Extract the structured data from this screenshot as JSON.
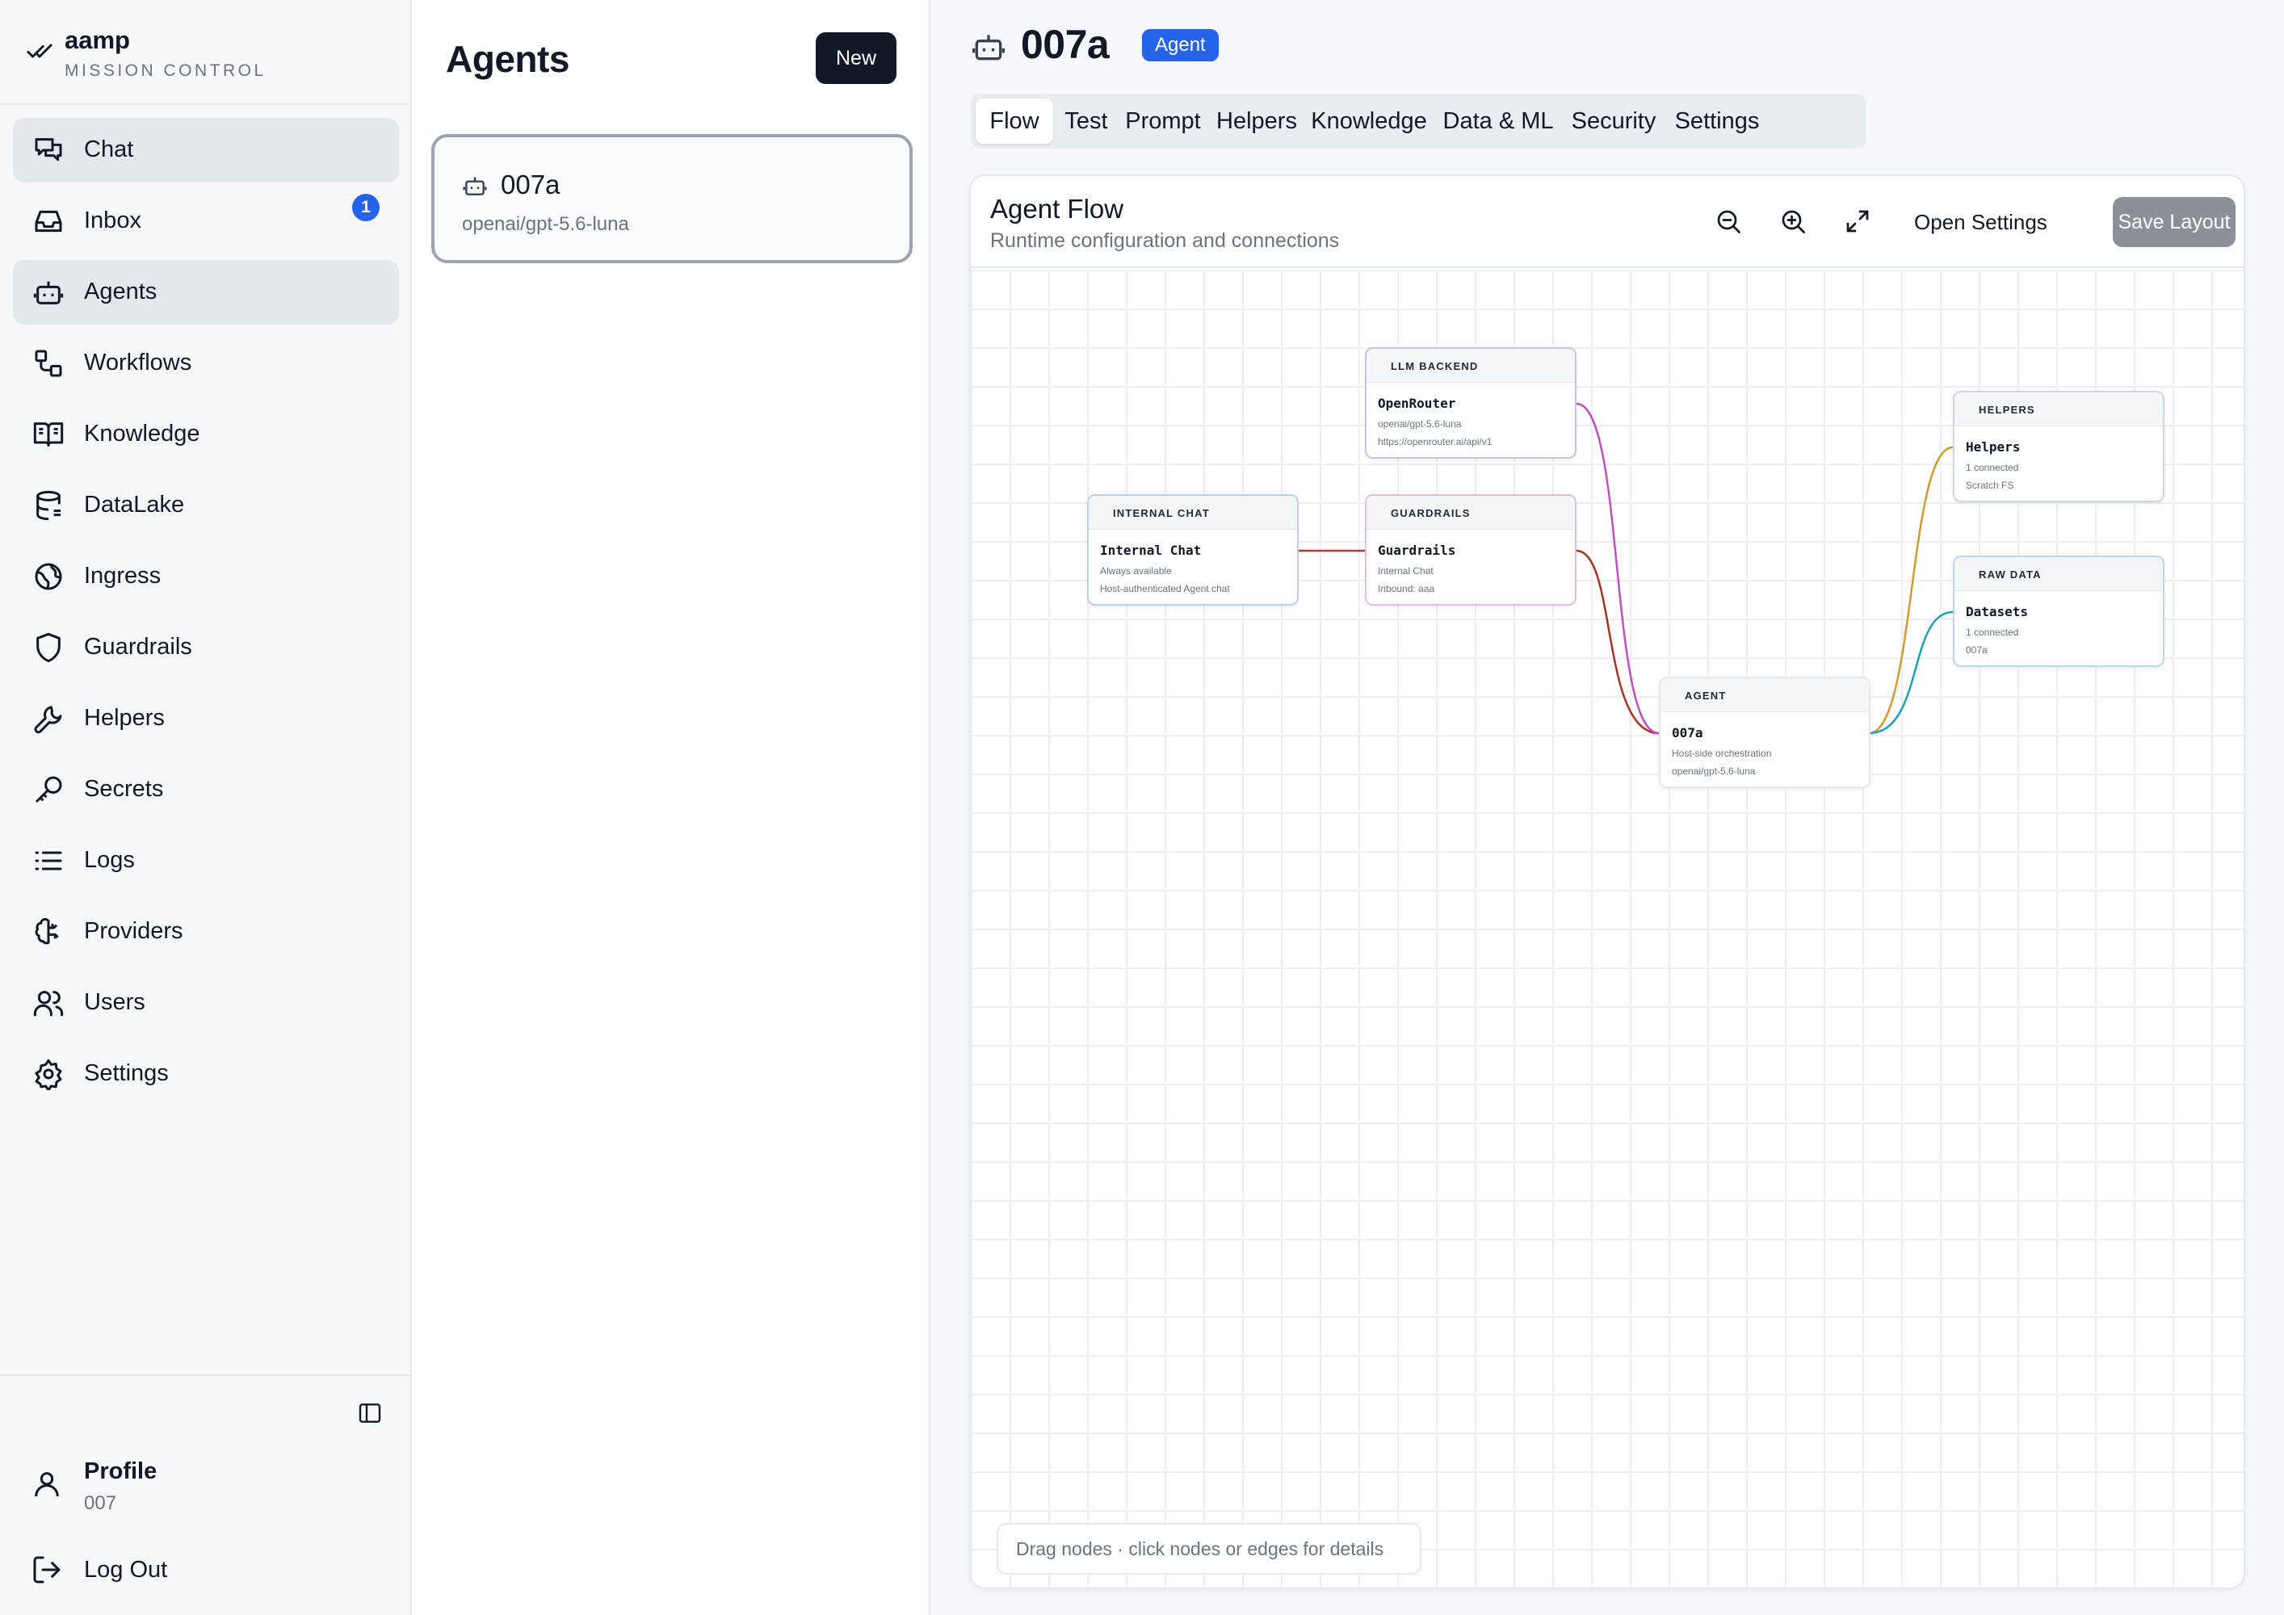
{
  "brand": {
    "name": "aamp",
    "subtitle": "MISSION CONTROL"
  },
  "sidebar": {
    "items": [
      {
        "label": "Chat",
        "icon": "chat-icon",
        "active": true
      },
      {
        "label": "Inbox",
        "icon": "inbox-icon",
        "badge": "1"
      },
      {
        "label": "Agents",
        "icon": "robot-icon",
        "active": true
      },
      {
        "label": "Workflows",
        "icon": "workflow-icon"
      },
      {
        "label": "Knowledge",
        "icon": "book-icon"
      },
      {
        "label": "DataLake",
        "icon": "database-icon"
      },
      {
        "label": "Ingress",
        "icon": "globe-icon"
      },
      {
        "label": "Guardrails",
        "icon": "shield-icon"
      },
      {
        "label": "Helpers",
        "icon": "wrench-icon"
      },
      {
        "label": "Secrets",
        "icon": "key-icon"
      },
      {
        "label": "Logs",
        "icon": "list-icon"
      },
      {
        "label": "Providers",
        "icon": "brain-icon"
      },
      {
        "label": "Users",
        "icon": "users-icon"
      },
      {
        "label": "Settings",
        "icon": "gear-icon"
      }
    ],
    "profile": {
      "name": "Profile",
      "sub": "007"
    },
    "logout_label": "Log Out"
  },
  "agents_list": {
    "title": "Agents",
    "new_label": "New",
    "cards": [
      {
        "name": "007a",
        "model": "openai/gpt-5.6-luna"
      }
    ]
  },
  "main": {
    "title": "007a",
    "badge": "Agent",
    "tabs": [
      {
        "label": "Flow",
        "active": true
      },
      {
        "label": "Test"
      },
      {
        "label": "Prompt"
      },
      {
        "label": "Helpers"
      },
      {
        "label": "Knowledge"
      },
      {
        "label": "Data & ML"
      },
      {
        "label": "Security"
      },
      {
        "label": "Settings"
      }
    ],
    "flow": {
      "title": "Agent Flow",
      "subtitle": "Runtime configuration and connections",
      "open_settings_label": "Open Settings",
      "save_label": "Save Layout",
      "hint": "Drag nodes · click nodes or edges for details",
      "nodes": {
        "llm": {
          "kind": "LLM BACKEND",
          "title": "OpenRouter",
          "line1": "openai/gpt-5.6-luna",
          "line2": "https://openrouter.ai/api/v1"
        },
        "chat": {
          "kind": "INTERNAL CHAT",
          "title": "Internal Chat",
          "line1": "Always available",
          "line2": "Host-authenticated Agent chat"
        },
        "guard": {
          "kind": "GUARDRAILS",
          "title": "Guardrails",
          "line1": "Internal Chat",
          "line2": "Inbound: aaa"
        },
        "agent": {
          "kind": "AGENT",
          "title": "007a",
          "line1": "Host-side orchestration",
          "line2": "openai/gpt-5.6-luna"
        },
        "helpers": {
          "kind": "HELPERS",
          "title": "Helpers",
          "line1": "1 connected",
          "line2": "Scratch FS"
        },
        "raw": {
          "kind": "RAW DATA",
          "title": "Datasets",
          "line1": "1 connected",
          "line2": "007a"
        }
      },
      "edge_colors": {
        "chat_guard": "#c0392b",
        "guard_agent": "#a93226",
        "llm_agent": "#c04fbf",
        "agent_helpers": "#d39a2f",
        "agent_raw": "#1aa3b8"
      }
    }
  }
}
